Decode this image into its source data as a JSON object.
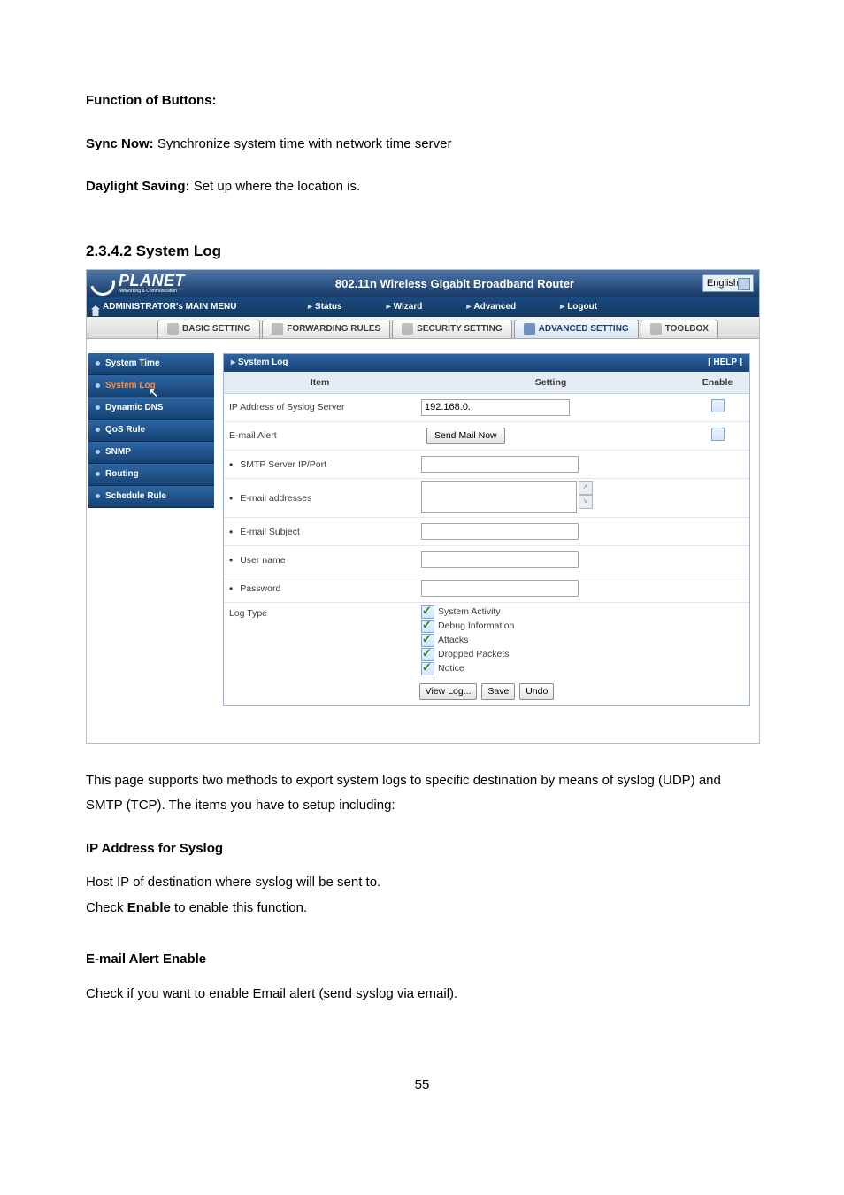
{
  "doc": {
    "function_heading": "Function of Buttons:",
    "sync_label": "Sync Now:",
    "sync_text": " Synchronize system time with network time server",
    "daylight_label": "Daylight Saving:",
    "daylight_text": " Set up where the location is.",
    "section_num_title": "2.3.4.2 System Log",
    "desc_para": "This page supports two methods to export system logs to specific destination by means of syslog (UDP) and SMTP (TCP). The items you have to setup including:",
    "ip_syslog_head": "IP Address for Syslog",
    "ip_syslog_l1a": "Host IP of destination where syslog will be sent to.",
    "ip_syslog_l2a": "Check ",
    "ip_syslog_l2b": "Enable",
    "ip_syslog_l2c": " to enable this function.",
    "email_alert_head": "E-mail Alert Enable",
    "email_alert_text": "Check if you want to enable Email alert (send syslog via email).",
    "page_number": "55"
  },
  "shot": {
    "logo_text": "PLANET",
    "logo_sub": "Networking & Communication",
    "product": "802.11n Wireless Gigabit Broadband Router",
    "language": "English",
    "menubar_main": "ADMINISTRATOR's MAIN MENU",
    "menubar_links": [
      "Status",
      "Wizard",
      "Advanced",
      "Logout"
    ],
    "tabs": [
      "BASIC SETTING",
      "FORWARDING RULES",
      "SECURITY SETTING",
      "ADVANCED SETTING",
      "TOOLBOX"
    ],
    "active_tab_index": 3,
    "sidebar_items": [
      "System Time",
      "System Log",
      "Dynamic DNS",
      "QoS Rule",
      "SNMP",
      "Routing",
      "Schedule Rule"
    ],
    "sidebar_active_index": 1,
    "panel_title": "System Log",
    "help_label": "[ HELP ]",
    "columns": {
      "item": "Item",
      "setting": "Setting",
      "enable": "Enable"
    },
    "rows": {
      "syslog_ip": {
        "label": "IP Address of Syslog Server",
        "value": "192.168.0."
      },
      "email_alert": {
        "label": "E-mail Alert",
        "button": "Send Mail Now"
      },
      "smtp": {
        "label": "SMTP Server IP/Port",
        "value": ""
      },
      "emails": {
        "label": "E-mail addresses",
        "value": ""
      },
      "subject": {
        "label": "E-mail Subject",
        "value": ""
      },
      "user": {
        "label": "User name",
        "value": ""
      },
      "pass": {
        "label": "Password",
        "value": ""
      },
      "logtype": {
        "label": "Log Type",
        "options": [
          {
            "label": "System Activity",
            "checked": true
          },
          {
            "label": "Debug Information",
            "checked": true
          },
          {
            "label": "Attacks",
            "checked": true
          },
          {
            "label": "Dropped Packets",
            "checked": true
          },
          {
            "label": "Notice",
            "checked": true
          }
        ]
      }
    },
    "buttons": {
      "view": "View Log...",
      "save": "Save",
      "undo": "Undo"
    }
  }
}
